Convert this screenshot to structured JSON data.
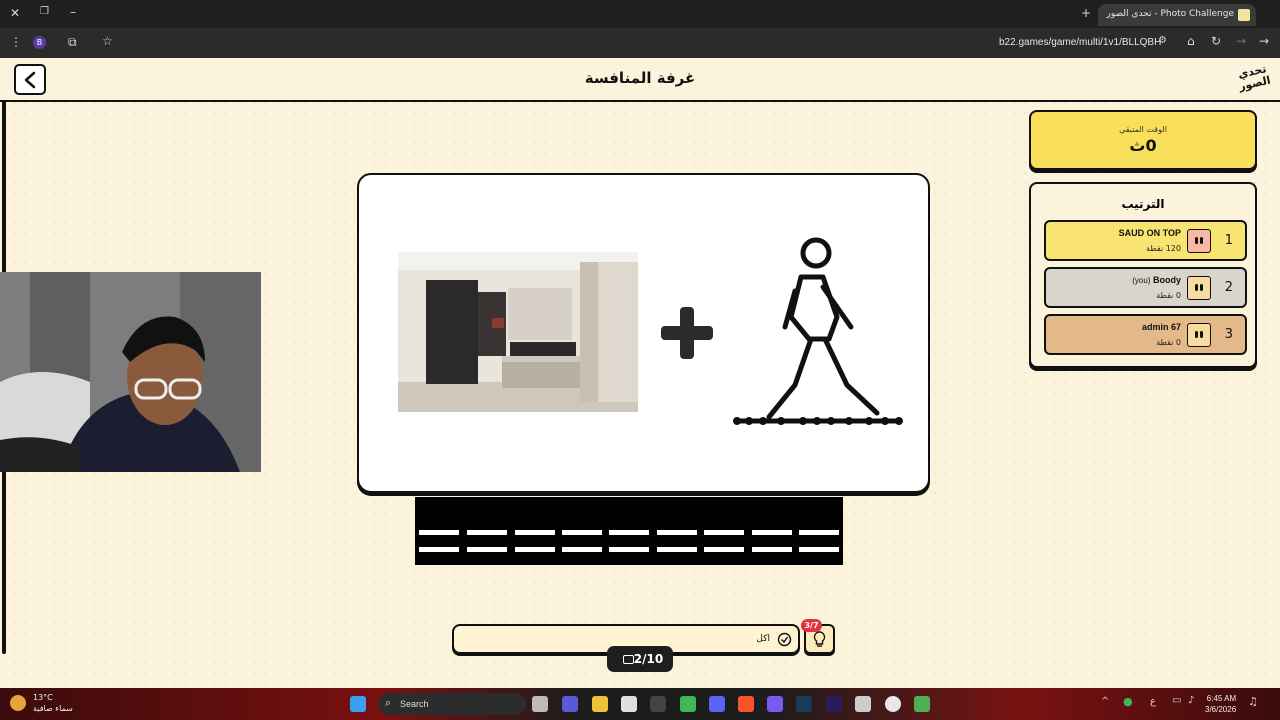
{
  "browser": {
    "tab_title": "Photo Challenge - تحدي الصور",
    "url": "b22.games/game/multi/1v1/BLLQBH",
    "profile_initial": "B",
    "window_controls": [
      "close-icon",
      "maximize-icon",
      "minimize-icon"
    ]
  },
  "header": {
    "title": "غرفة المنافسة",
    "logo_text": "تحدي الصور"
  },
  "timer": {
    "label": "الوقت المتبقي",
    "value": "0ث"
  },
  "ranking": {
    "title": "الترتيب",
    "players": [
      {
        "rank": "1",
        "name": "SAUD ON TOP",
        "you_tag": "",
        "points": "120 نقطة",
        "color": "#f9e472"
      },
      {
        "rank": "2",
        "name": "Boody",
        "you_tag": "(you)",
        "points": "0 نقطة",
        "color": "#d8d5ca"
      },
      {
        "rank": "3",
        "name": "admin 67",
        "you_tag": "",
        "points": "0 نقطة",
        "color": "#e3b98a"
      }
    ]
  },
  "puzzle": {
    "left_image": "bedroom-photo",
    "operator": "+",
    "right_image": "walking-person-icon",
    "answer_slots": 18
  },
  "answer_input": {
    "placeholder": "اكل",
    "hint_badge": "3/7"
  },
  "progress": {
    "text": "2/10"
  },
  "taskbar": {
    "weather_temp": "13°C",
    "weather_desc": "سماء صافية",
    "search_label": "Search",
    "time": "6:45 AM",
    "date": "3/6/2026",
    "lang": "ع"
  }
}
